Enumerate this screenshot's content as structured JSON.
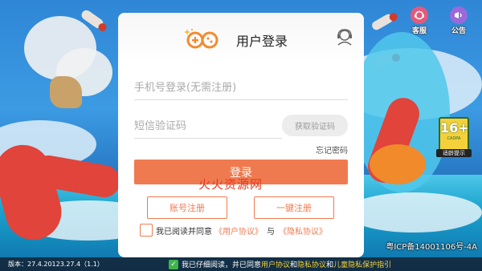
{
  "dialog": {
    "title": "用户登录",
    "phone_placeholder": "手机号登录(无需注册)",
    "code_placeholder": "短信验证码",
    "get_code_label": "获取验证码",
    "forgot_label": "忘记密码",
    "login_label": "登录",
    "account_register_label": "账号注册",
    "onekey_register_label": "一键注册",
    "agree_prefix": "我已阅读并同意",
    "user_agreement": "《用户协议》",
    "agree_and": "与",
    "privacy_agreement": "《隐私协议》",
    "accent_color": "#f07a4f"
  },
  "watermark": "火火资源网",
  "top_icons": [
    {
      "icon": "customer-service-icon",
      "label": "客服"
    },
    {
      "icon": "announcement-icon",
      "label": "公告"
    }
  ],
  "age_badge": {
    "rating": "16+",
    "sub": "CADPA",
    "label": "适龄提示"
  },
  "footer": {
    "version": "版本：27.4.20123.27.4（1.1）",
    "icp": "粤ICP备14001106号-4A",
    "agree_text_prefix": "我已仔细阅读，并已同意",
    "agree_user": "用户协议",
    "agree_and1": "和",
    "agree_privacy": "隐私协议",
    "agree_and2": "和",
    "agree_child": "儿童隐私保护指引"
  }
}
